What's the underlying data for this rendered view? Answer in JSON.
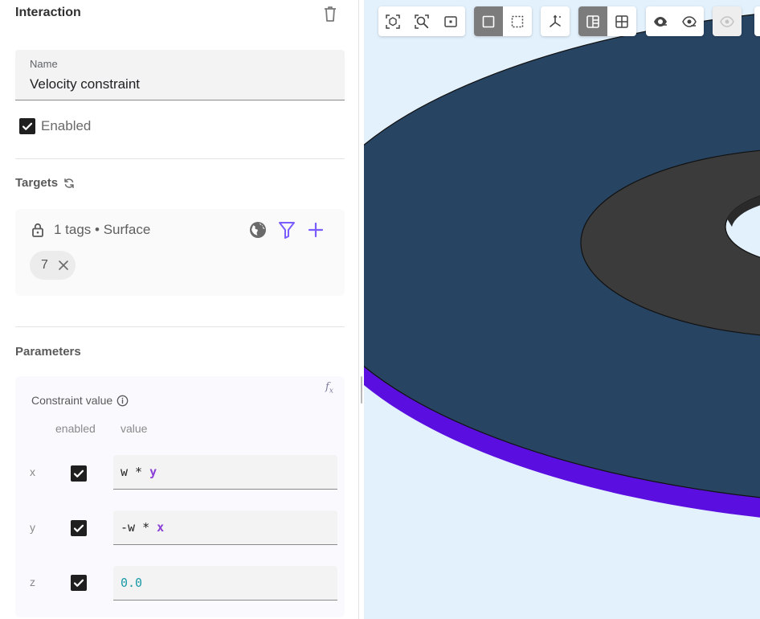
{
  "panel": {
    "title": "Interaction",
    "name_field": {
      "label": "Name",
      "value": "Velocity constraint"
    },
    "enabled": {
      "label": "Enabled",
      "checked": true
    }
  },
  "targets": {
    "title": "Targets",
    "summary": "1 tags • Surface",
    "chips": [
      {
        "label": "7"
      }
    ]
  },
  "parameters": {
    "title": "Parameters",
    "constraint_label": "Constraint value",
    "columns": {
      "enabled": "enabled",
      "value": "value"
    },
    "rows": [
      {
        "axis": "x",
        "enabled": true,
        "tokens": [
          {
            "t": "w * ",
            "k": "plain"
          },
          {
            "t": "y",
            "k": "var"
          }
        ]
      },
      {
        "axis": "y",
        "enabled": true,
        "tokens": [
          {
            "t": "-w * ",
            "k": "plain"
          },
          {
            "t": "x",
            "k": "var"
          }
        ]
      },
      {
        "axis": "z",
        "enabled": true,
        "tokens": [
          {
            "t": "0.0",
            "k": "num"
          }
        ]
      }
    ]
  },
  "viewport": {
    "background": "#e3f1fc",
    "colors": {
      "outer_disk": "#274462",
      "inner_ring": "#3b3b3b",
      "rim": "#5a0fe0",
      "hole": "#e3f1fc"
    },
    "toolbar_groups": [
      {
        "buttons": [
          {
            "icon": "zoom-fit-icon"
          },
          {
            "icon": "zoom-region-icon"
          },
          {
            "icon": "zoom-selection-icon"
          }
        ]
      },
      {
        "buttons": [
          {
            "icon": "select-box-icon",
            "active": true
          },
          {
            "icon": "select-dashed-icon"
          }
        ]
      },
      {
        "buttons": [
          {
            "icon": "axes-icon"
          }
        ]
      },
      {
        "buttons": [
          {
            "icon": "section-view-icon",
            "active": true
          },
          {
            "icon": "grid-view-icon"
          }
        ]
      },
      {
        "buttons": [
          {
            "icon": "hide-icon"
          },
          {
            "icon": "show-icon"
          }
        ]
      },
      {
        "buttons": [
          {
            "icon": "eye-disabled-icon"
          }
        ],
        "disabled": true
      }
    ]
  }
}
